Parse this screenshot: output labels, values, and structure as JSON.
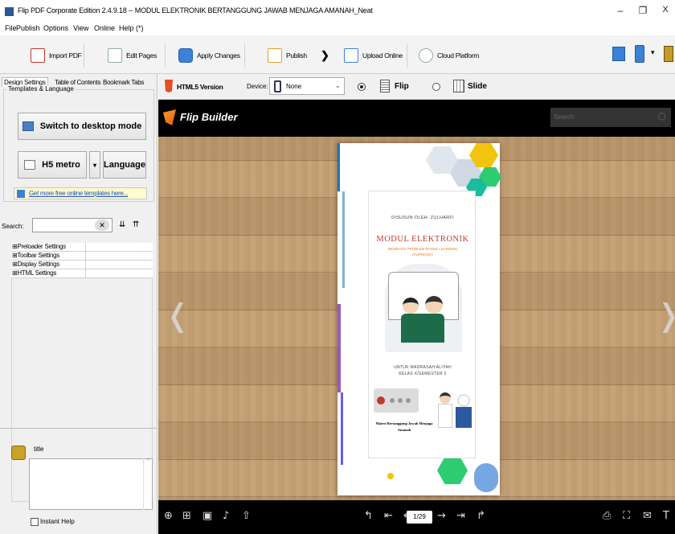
{
  "window": {
    "title": "Flip PDF Corporate Edition 2.4.9.18 -- MODUL ELEKTRONIK BERTANGGUNG JAWAB MENJAGA AMANAH_Neat",
    "minimize": "–",
    "maximize": "❐",
    "close": "X"
  },
  "menu": [
    "File",
    "Publish",
    "Options",
    "View",
    "Online",
    "Help (*)"
  ],
  "toolbar": {
    "import": "Import PDF",
    "edit": "Edit Pages",
    "apply": "Apply Changes",
    "publish": "Publish",
    "arrow": "❯",
    "upload": "Upload Online",
    "cloud": "Cloud Platform"
  },
  "left": {
    "tabs": [
      "Design Settings",
      "Table of Contents",
      "Bookmark Tabs"
    ],
    "group": "Templates & Language",
    "switch_btn": "Switch to desktop mode",
    "template_btn": "H5 metro",
    "language_btn": "Language",
    "more_link": "Get more free online templates here...",
    "search_label": "Search:",
    "props": [
      "⊞Preloader Settings",
      "⊞Toolbar Settings",
      "⊞Display Settings",
      "⊞HTML Settings"
    ],
    "help_title": "title",
    "instant_help": "Instant Help"
  },
  "device_bar": {
    "version": "HTML5 Version",
    "device_label": "Device:",
    "device_value": "None",
    "flip": "Flip",
    "slide": "Slide"
  },
  "preview": {
    "brand": "Flip Builder",
    "search_placeholder": "Search",
    "page_indicator": "1/29"
  },
  "cover": {
    "author": "DISUSUN OLEH: ZULHARFI",
    "title": "MODUL ELEKTRONIK",
    "subtitle1": "BERBASIS PROBLEM BASED LEARNING",
    "subtitle2": "(FLIPBOOK)",
    "audience1": "UNTUK MADRASAH ALIYAH",
    "audience2": "KELAS X/SEMESTER 2",
    "materi1": "Materi Bertanggung Jawab Menjaga",
    "materi2": "Amanah"
  },
  "colors": {
    "accent": "#c0392b",
    "dark": "#000000",
    "wood": "#b8956a"
  }
}
